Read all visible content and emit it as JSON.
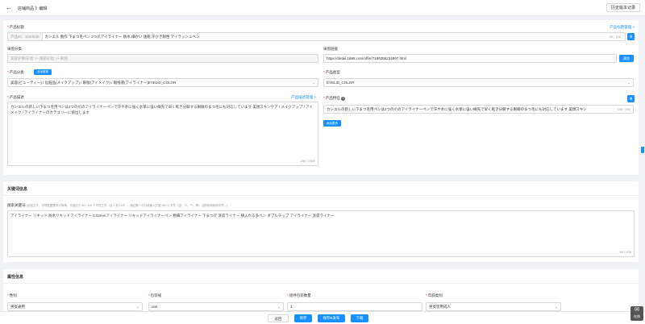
{
  "header": {
    "breadcrumb": "店铺商品 》编辑",
    "history_button": "历史版本记录"
  },
  "product_title": {
    "label": "产品标题",
    "link": "产品标题管理 >",
    "prefix": "产品ID：1040630",
    "value": "カシエル 製作 下まつ毛ペン 2つ爪アイライナー 防水 細かい 速乾 汗かき耐性 アイラッシュペン",
    "count": "98 / 100",
    "btn": "译"
  },
  "purchase_category": {
    "label": "采购分类",
    "value": "美容护肤/彩妆 >> 眼部彩妆 >> 眼线"
  },
  "purchase_link": {
    "label": "采购链接",
    "value": "https://detail.1688.com/offer/7189256234897.html",
    "btn": "预览"
  },
  "product_category": {
    "label": "产品分类",
    "tag": "自动推荐",
    "value": "美容(ビューティー) / 化粧品(メイクアップ) / 眼妆(アイメイク) / 眼线液(アイライナー)EYELID_COLOR"
  },
  "product_type": {
    "label": "产品类型",
    "value": "EYELID_COLOR"
  },
  "product_desc": {
    "label": "产品描述",
    "link": "产品描述管理 >",
    "value": "カシエルの新しい下まつ毛用ペンは2つの爪のアイライナーペンで汗や水に強く水草に強い線先で早く乾き分解する眼瞼のまつ毛にも対応しています 美顔スキンケア / メイクアップ / アイメイク / アイライナーのカテゴリーに値出します",
    "count": "186 / 2000"
  },
  "product_feature": {
    "label": "产品特征",
    "value": "カシエルの新しい下まつ毛用ペンは2つの爪のアイライナーペンで汗や水に強く水草に強い線先で早く乾き分解する眼瞼のまつ毛にも対応しています 美顔スキン",
    "count": "136 / 250",
    "btn": "译",
    "add_btn": "添加更多"
  },
  "keywords_section": {
    "title": "关键词信息",
    "label": "搜索关键词",
    "hint": "(包括空字、字母数据需求计算单、长度应于 80 / 100 个字符之内（含 1 到 100）... 通过第一次分组输入扩展 ASCII 字符（如：°C、™、等）当前检测到和字符。)",
    "value": "アイライナー リキッド 防水リキッドアイライナー 0.02mmアイライナー リキッドアイライナーペン 極細アイライナー 下まつげ 涙袋ライナー 横入れる多ペン ダブルチップ アイライナー 涙袋ライナー",
    "count": "90 / 100"
  },
  "attributes_section": {
    "title": "属性信息",
    "fields": [
      {
        "label": "性别",
        "value": "男女通用"
      },
      {
        "label": "包装规",
        "value": "unit"
      },
      {
        "label": "组件包装数量",
        "value": "1"
      },
      {
        "label": "年龄类别",
        "value": "男女皆用成人"
      }
    ]
  },
  "footer": {
    "back": "返回",
    "save": "保存",
    "save_publish": "保存&发布",
    "publish": "下载"
  },
  "chat": {
    "label": "在线"
  }
}
